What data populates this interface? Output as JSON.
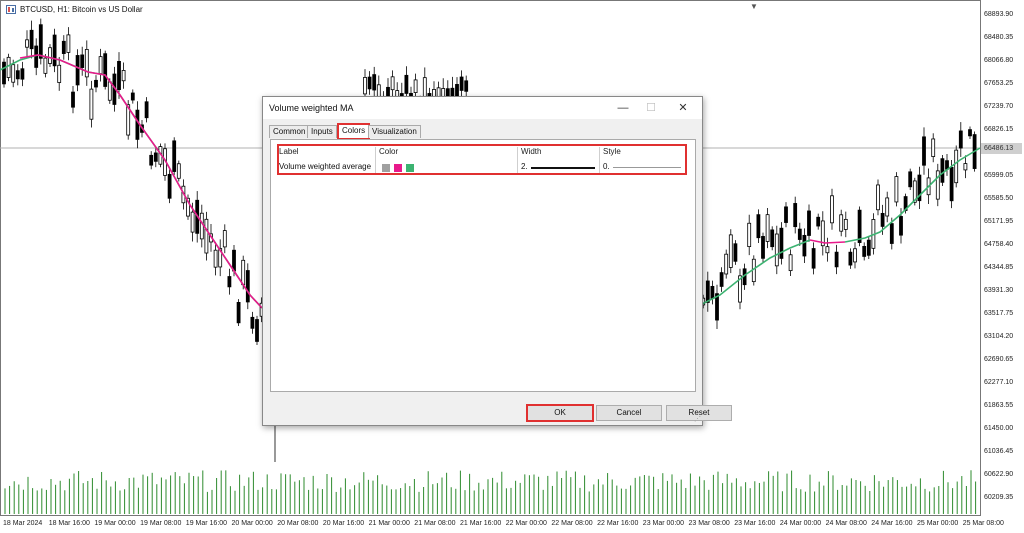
{
  "chart": {
    "symbol_title": "BTCUSD, H1: Bitcoin vs US Dollar",
    "current_price": "66486.13",
    "price_axis": [
      "68893.90",
      "68480.35",
      "68066.80",
      "67653.25",
      "67239.70",
      "66826.15",
      "66412.60",
      "65999.05",
      "65585.50",
      "65171.95",
      "64758.40",
      "64344.85",
      "63931.30",
      "63517.75",
      "63104.20",
      "62690.65",
      "62277.10",
      "61863.55",
      "61450.00",
      "61036.45",
      "60622.90",
      "60209.35"
    ],
    "time_axis": [
      "18 Mar 2024",
      "18 Mar 16:00",
      "19 Mar 00:00",
      "19 Mar 08:00",
      "19 Mar 16:00",
      "20 Mar 00:00",
      "20 Mar 08:00",
      "20 Mar 16:00",
      "21 Mar 00:00",
      "21 Mar 08:00",
      "21 Mar 16:00",
      "22 Mar 00:00",
      "22 Mar 08:00",
      "22 Mar 16:00",
      "23 Mar 00:00",
      "23 Mar 08:00",
      "23 Mar 16:00",
      "24 Mar 00:00",
      "24 Mar 08:00",
      "24 Mar 16:00",
      "25 Mar 00:00",
      "25 Mar 08:00"
    ],
    "colors": {
      "ma_pink": "#e8198b",
      "ma_green": "#3cb371",
      "volume": "#2e8b2e",
      "candle": "#000000"
    }
  },
  "dialog": {
    "title": "Volume weighted MA",
    "window_buttons": {
      "minimize": "—",
      "maximize": "☐",
      "close": "✕"
    },
    "tabs": [
      {
        "label": "Common",
        "active": false
      },
      {
        "label": "Inputs",
        "active": false
      },
      {
        "label": "Colors",
        "active": true
      },
      {
        "label": "Visualization",
        "active": false
      }
    ],
    "colors_table": {
      "headers": {
        "label": "Label",
        "color": "Color",
        "width": "Width",
        "style": "Style"
      },
      "rows": [
        {
          "label": "Volume weighted average",
          "swatches": [
            "#a0a0a0",
            "#e8198b",
            "#3cb371"
          ],
          "width": "2.",
          "style": "0."
        }
      ]
    },
    "buttons": {
      "ok": "OK",
      "cancel": "Cancel",
      "reset": "Reset"
    }
  }
}
